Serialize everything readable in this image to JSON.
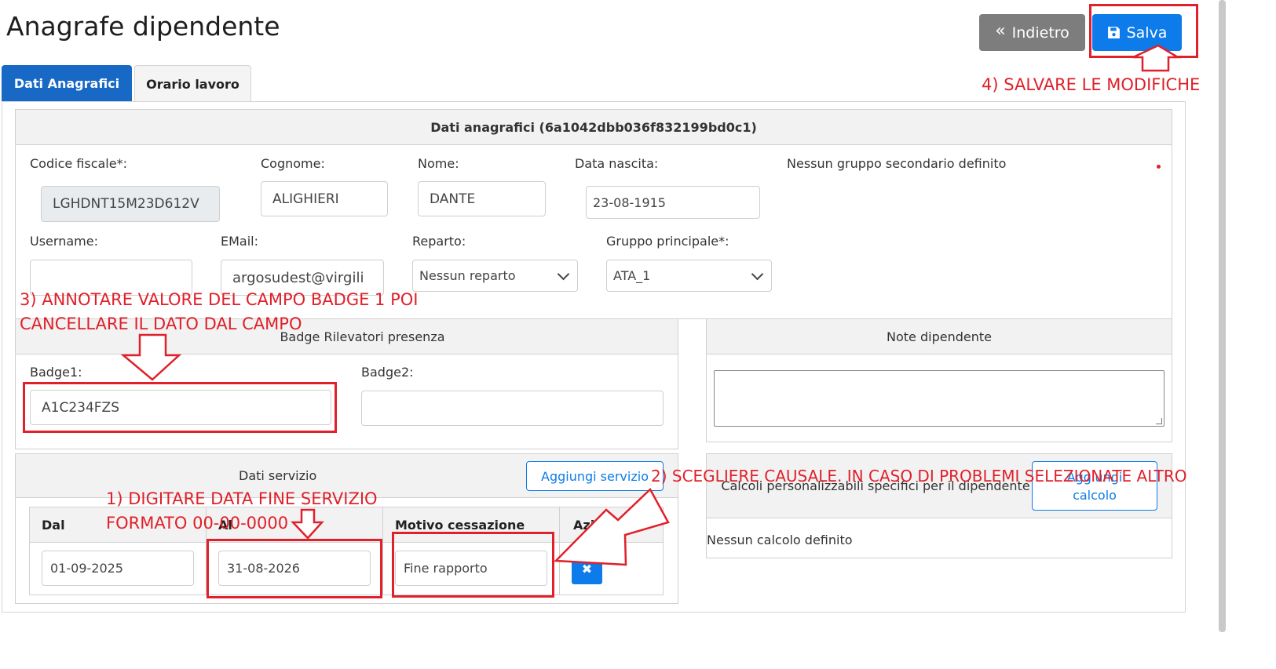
{
  "header": {
    "title": "Anagrafe dipendente",
    "back_label": "Indietro",
    "save_label": "Salva"
  },
  "tabs": [
    {
      "label": "Dati Anagrafici",
      "active": true
    },
    {
      "label": "Orario lavoro",
      "active": false
    }
  ],
  "anagrafica": {
    "title": "Dati anagrafici (6a1042dbb036f832199bd0c1)",
    "codice_fiscale": {
      "label": "Codice fiscale*:",
      "value": "LGHDNT15M23D612V"
    },
    "cognome": {
      "label": "Cognome:",
      "value": "ALIGHIERI"
    },
    "nome": {
      "label": "Nome:",
      "value": "DANTE"
    },
    "data_nascita": {
      "label": "Data nascita:",
      "value": "23-08-1915"
    },
    "gruppi_secondari": "Nessun gruppo secondario definito",
    "username": {
      "label": "Username:",
      "value": ""
    },
    "email": {
      "label": "EMail:",
      "value": "argosudest@virgili"
    },
    "reparto": {
      "label": "Reparto:",
      "value": "Nessun reparto"
    },
    "gruppo_principale": {
      "label": "Gruppo principale*:",
      "value": "ATA_1"
    }
  },
  "badge": {
    "title": "Badge Rilevatori presenza",
    "badge1": {
      "label": "Badge1:",
      "value": "A1C234FZS"
    },
    "badge2": {
      "label": "Badge2:",
      "value": ""
    }
  },
  "note_dipendente": {
    "title": "Note dipendente",
    "value": ""
  },
  "servizio": {
    "title": "Dati servizio",
    "add_label": "Aggiungi servizio",
    "columns": [
      "Dal",
      "Al",
      "Motivo cessazione",
      "Azione"
    ],
    "rows": [
      {
        "dal": "01-09-2025",
        "al": "31-08-2026",
        "motivo": "Fine rapporto"
      }
    ]
  },
  "calcoli": {
    "title": "Calcoli personalizzabili specifici per il dipendente",
    "add_label": "Aggiungi calcolo",
    "empty": "Nessun calcolo definito"
  },
  "annotations": {
    "step1_line1": "1) DIGITARE DATA FINE SERVIZIO",
    "step1_line2": "FORMATO 00-00-0000",
    "step2": "2) SCEGLIERE CAUSALE. IN CASO DI PROBLEMI SELEZIONATE ALTRO",
    "step3_line1": "3) ANNOTARE VALORE DEL CAMPO BADGE 1 POI",
    "step3_line2": "CANCELLARE IL DATO DAL CAMPO",
    "step4": "4) SALVARE LE MODIFICHE",
    "color": "#e0202a"
  },
  "colors": {
    "primary": "#0d7bea",
    "tab_active": "#1769c5",
    "secondary": "#7d7d7d"
  }
}
